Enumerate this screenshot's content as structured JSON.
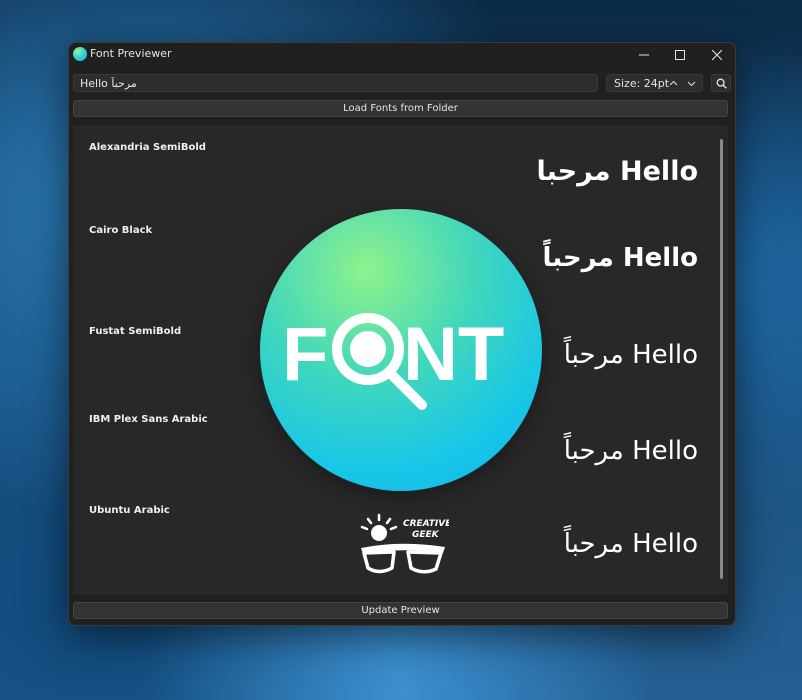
{
  "window": {
    "title": "Font Previewer"
  },
  "toolbar": {
    "preview_text": "مرحباً Hello",
    "size_label": "Size: 24pt",
    "load_button": "Load Fonts from Folder",
    "update_button": "Update Preview"
  },
  "fonts": [
    {
      "name": "Alexandria SemiBold",
      "sample": "مرحبا Hello"
    },
    {
      "name": "Cairo Black",
      "sample": "مرحباً Hello"
    },
    {
      "name": "Fustat SemiBold",
      "sample": "مرحباً Hello"
    },
    {
      "name": "IBM Plex Sans Arabic",
      "sample": "مرحباً Hello"
    },
    {
      "name": "Ubuntu Arabic",
      "sample": "مرحباً Hello"
    }
  ],
  "overlay": {
    "logo_text": "FONT",
    "badge_line1": "CREATIVE",
    "badge_line2": "GEEK"
  },
  "colors": {
    "window_bg": "#202020",
    "panel_bg": "#282828",
    "logo_gradient": [
      "#8ff28c",
      "#19c7e6",
      "#10b5ee"
    ]
  },
  "icons": {
    "app": "font-previewer-app-icon",
    "minimize": "minimize-icon",
    "maximize": "maximize-icon",
    "close": "close-icon",
    "search": "search-icon"
  }
}
